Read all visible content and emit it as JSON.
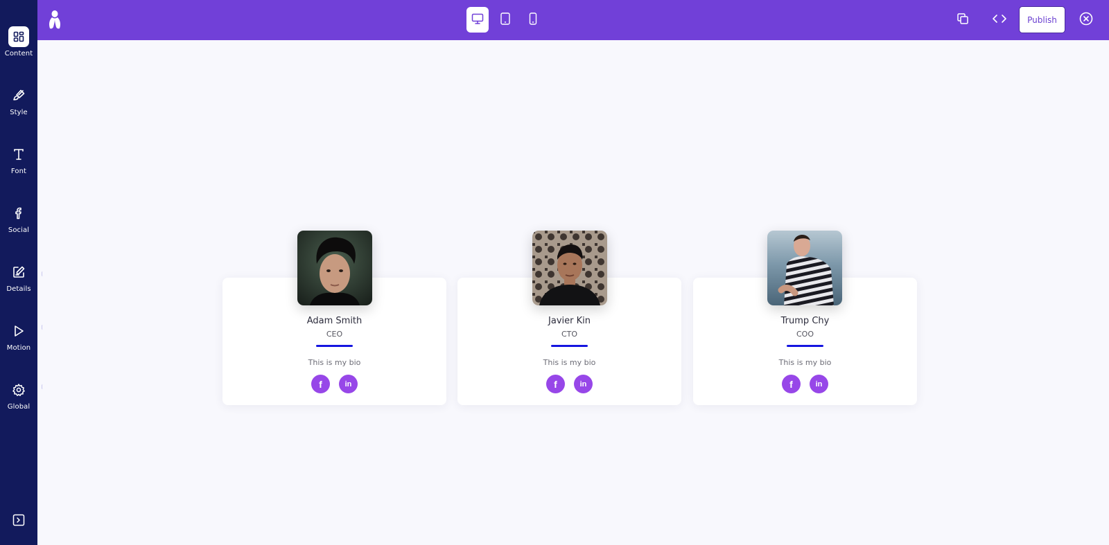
{
  "sidebar": {
    "items": [
      {
        "label": "Content",
        "icon": "layout-grid-icon",
        "active": true
      },
      {
        "label": "Style",
        "icon": "paintbrush-icon"
      },
      {
        "label": "Font",
        "icon": "type-icon"
      },
      {
        "label": "Social",
        "icon": "facebook-icon"
      },
      {
        "label": "Details",
        "icon": "edit-icon"
      },
      {
        "label": "Motion",
        "icon": "play-icon"
      },
      {
        "label": "Global",
        "icon": "gear-icon"
      }
    ],
    "collapse_icon": "panel-expand-icon"
  },
  "topbar": {
    "background": "#7140d8",
    "devices": [
      "desktop-icon",
      "tablet-icon",
      "mobile-icon"
    ],
    "active_device": "desktop",
    "publish_label": "Publish"
  },
  "team": [
    {
      "name": "Adam Smith",
      "role": "CEO",
      "bio": "This is my bio",
      "facebook": "f",
      "linkedin": "in"
    },
    {
      "name": "Javier Kin",
      "role": "CTO",
      "bio": "This is my bio",
      "facebook": "f",
      "linkedin": "in"
    },
    {
      "name": "Trump Chy",
      "role": "COO",
      "bio": "This is my bio",
      "facebook": "f",
      "linkedin": "in"
    }
  ],
  "colors": {
    "sidebar": "#121a5c",
    "accent": "#7140d8",
    "social": "#9747e8",
    "underline": "#1515e0"
  }
}
